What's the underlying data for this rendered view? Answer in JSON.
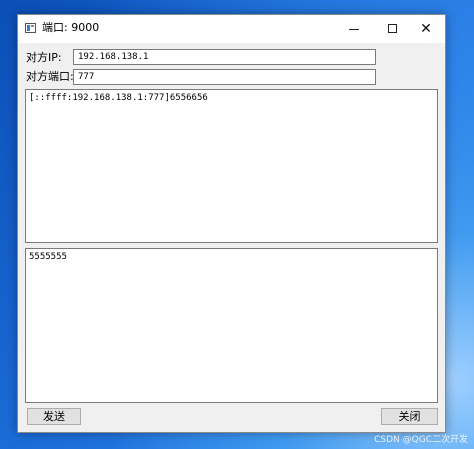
{
  "window": {
    "title": "端口: 9000",
    "minimize_glyph": "minimize-icon",
    "maximize_glyph": "maximize-icon",
    "close_glyph": "✕"
  },
  "form": {
    "ip_label": "对方IP:",
    "ip_value": "192.168.138.1",
    "port_label": "对方端口:",
    "port_value": "777"
  },
  "receive_box": {
    "text": "[::ffff:192.168.138.1:777]6556656"
  },
  "send_box": {
    "text": "5555555"
  },
  "buttons": {
    "send_label": "发送",
    "close_label": "关闭"
  },
  "watermark": "CSDN @QGC二次开发",
  "colors": {
    "desktop_accent": "#1c6cd8",
    "window_bg": "#f0f0f0",
    "button_bg": "#e1e1e1"
  }
}
